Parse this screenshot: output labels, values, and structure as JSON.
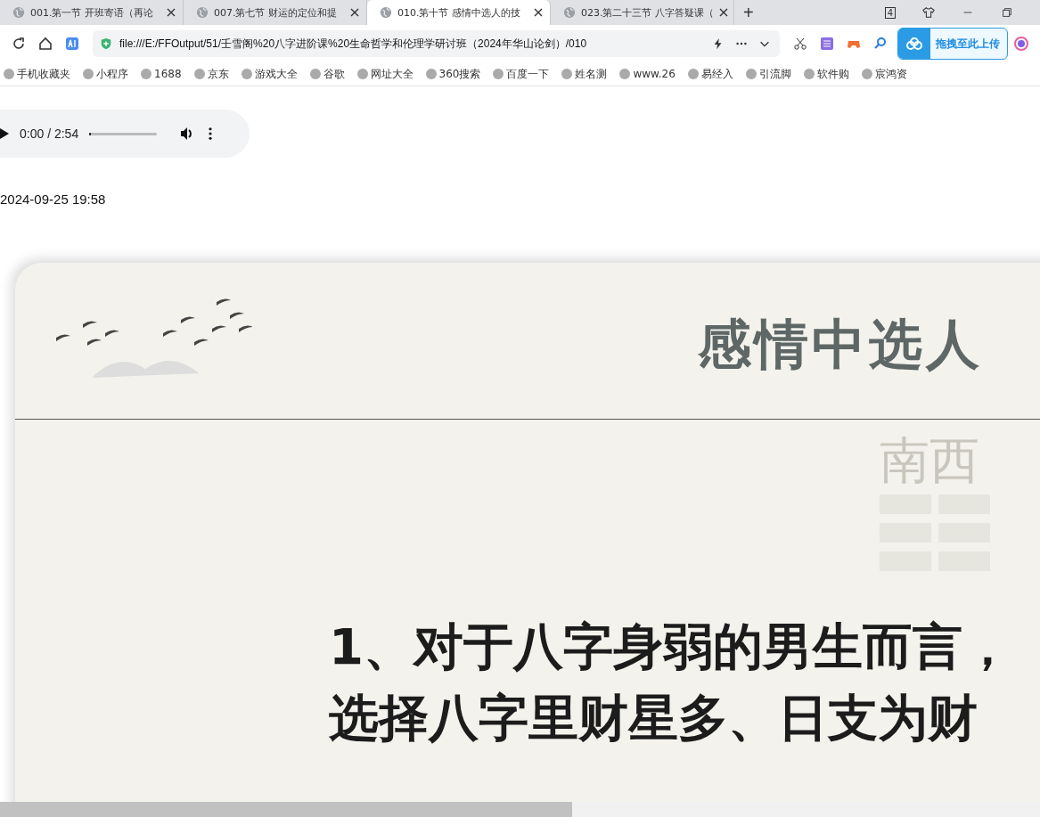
{
  "tabs": [
    {
      "title": "001.第一节 开班寄语（再论",
      "selected": false
    },
    {
      "title": "007.第七节 财运的定位和提",
      "selected": false
    },
    {
      "title": "010.第十节 感情中选人的技",
      "selected": true
    },
    {
      "title": "023.第二十三节 八字答疑课（",
      "selected": false
    }
  ],
  "new_tab": "+",
  "tab_count": "4",
  "address_bar": {
    "url": "file:///E:/FFOutput/51/壬雪阁%20八字进阶课%20生命哲学和伦理学研讨班（2024年华山论剑）/010"
  },
  "upload_button": "拖拽至此上传",
  "bookmarks": [
    "手机收藏夹",
    "小程序",
    "1688",
    "京东",
    "游戏大全",
    "谷歌",
    "网址大全",
    "360搜索",
    "百度一下",
    "姓名测",
    "www.26",
    "易经入",
    "引流脚",
    "软件购",
    "宸鸿资"
  ],
  "audio_player": {
    "time": "0:00 / 2:54",
    "level": 0
  },
  "timestamp": "2024-09-25 19:58",
  "slide": {
    "title": "感情中选人",
    "decor_label": "南西",
    "lines": [
      "1、对于八字身弱的男生而言，",
      "选择八字里财星多、日支为财"
    ]
  },
  "scrollbar": {
    "level": 0.55
  }
}
